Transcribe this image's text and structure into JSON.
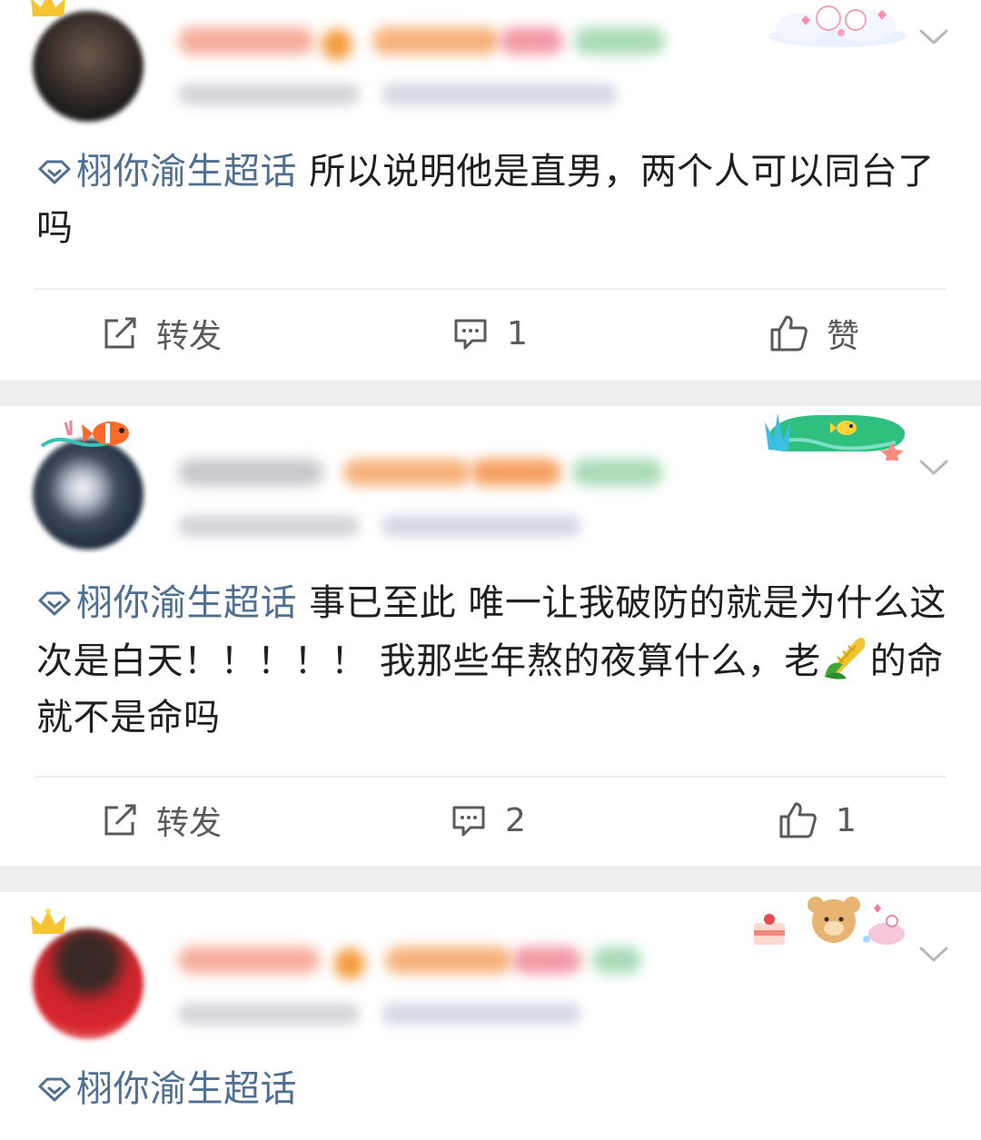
{
  "posts": [
    {
      "topic": "栩你渝生超话",
      "text": " 所以说明他是直男，两个人可以同台了吗",
      "actions": {
        "repost": "转发",
        "comment": "1",
        "like": "赞"
      }
    },
    {
      "topic": "栩你渝生超话",
      "text": "  事已至此 唯一让我破防的就是为什么这次是白天！！！！！ 我那些年熬的夜算什么，老",
      "text_tail": "的命就不是命吗",
      "emoji": "corn-emoji",
      "actions": {
        "repost": "转发",
        "comment": "2",
        "like": "1"
      }
    },
    {
      "topic": "栩你渝生超话",
      "actions": {}
    }
  ],
  "icons": {
    "repost": "repost-icon",
    "comment": "comment-icon",
    "like": "thumbs-up-icon",
    "more": "chevron-down-icon",
    "topic": "super-topic-diamond-icon"
  },
  "colors": {
    "topic": "#4f6f93",
    "text": "#1f1f1f",
    "action": "#5a5a5a",
    "background": "#eeeff1",
    "card": "#ffffff"
  }
}
